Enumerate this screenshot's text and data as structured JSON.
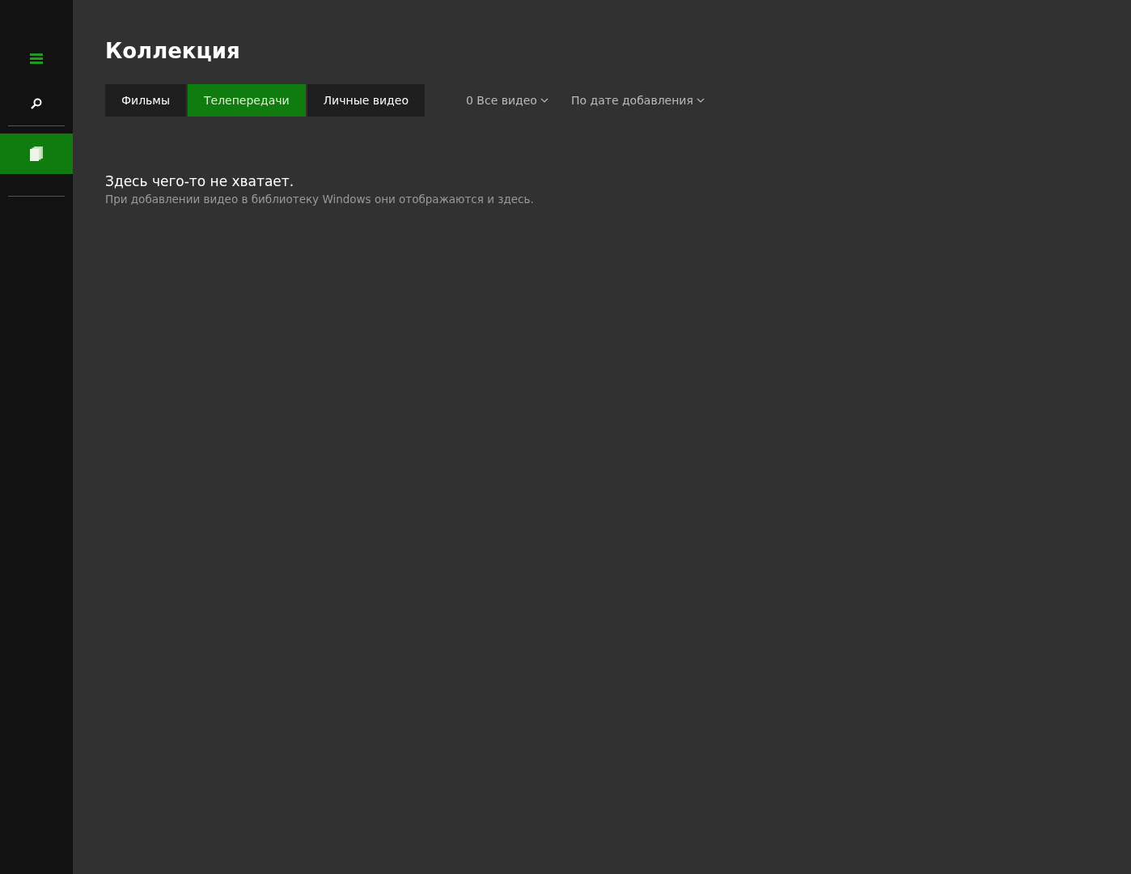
{
  "sidebar": {
    "items": [
      {
        "kind": "menu",
        "selected": false
      },
      {
        "kind": "search",
        "selected": false
      },
      {
        "kind": "collection",
        "selected": true
      }
    ]
  },
  "title": "Коллекция",
  "tabs": [
    {
      "label": "Фильмы",
      "selected": false
    },
    {
      "label": "Телепередачи",
      "selected": true
    },
    {
      "label": "Личные видео",
      "selected": false
    }
  ],
  "filters": [
    {
      "label": "0 Все видео"
    },
    {
      "label": "По дате добавления"
    }
  ],
  "empty_state": {
    "heading": "Здесь чего-то не хватает.",
    "message": "При добавлении видео в библиотеку Windows они отображаются и здесь."
  }
}
